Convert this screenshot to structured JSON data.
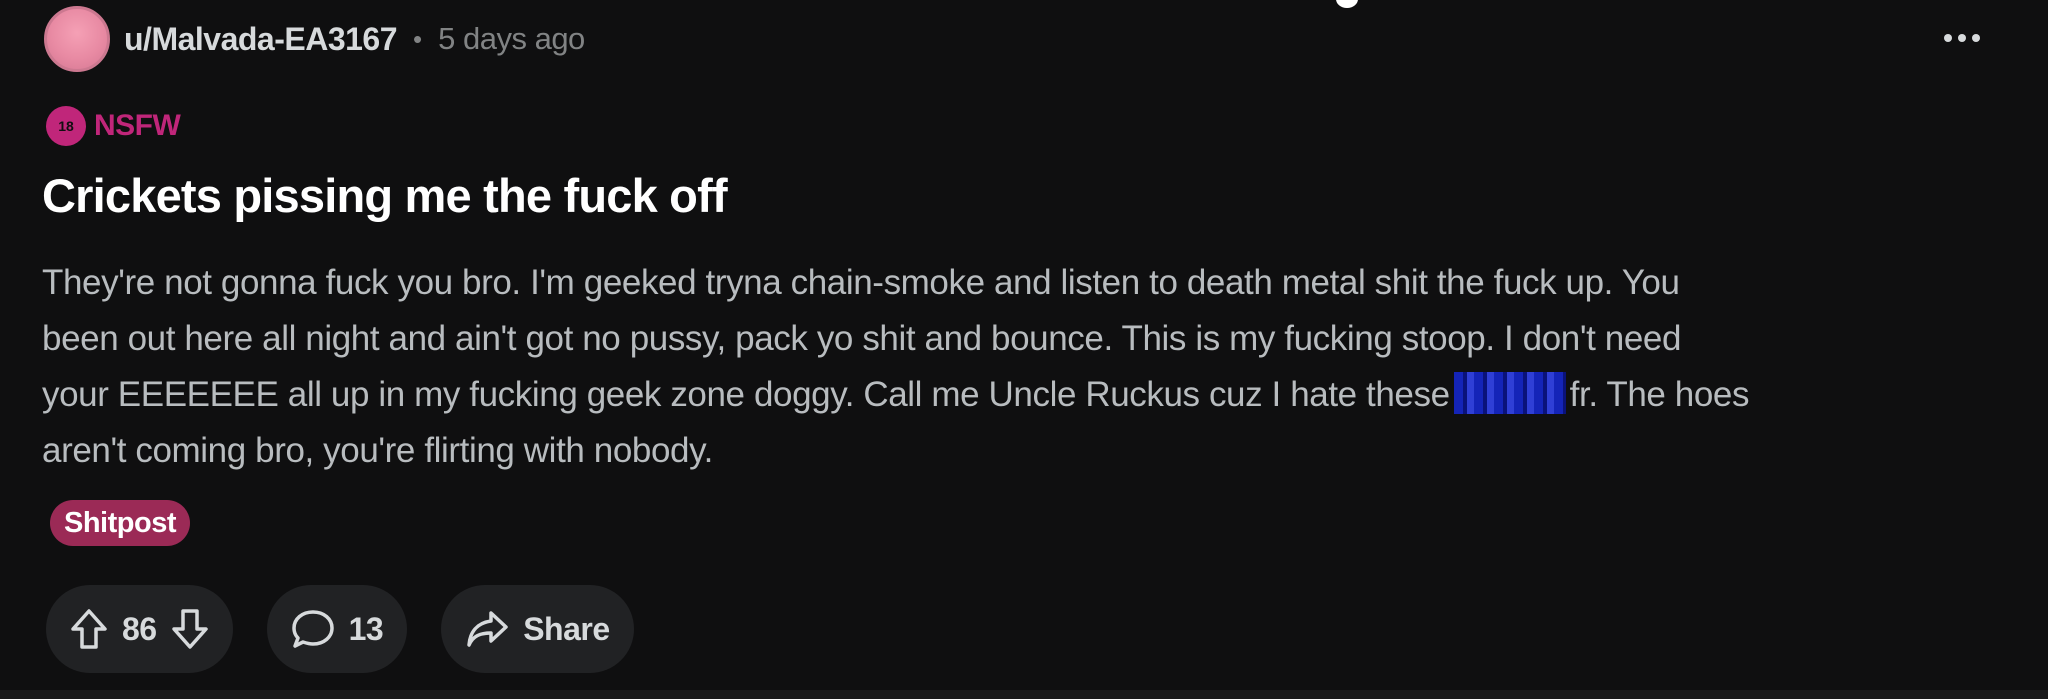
{
  "post": {
    "author": "u/Malvada-EA3167",
    "separator": "•",
    "time_ago": "5 days ago",
    "nsfw_label": "NSFW",
    "nsfw_badge_text": "18",
    "title": "Crickets pissing me the fuck off",
    "body_lines": [
      "They're not gonna fuck you bro. I'm geeked tryna chain-smoke and listen to death metal shit the fuck up. You",
      "been out here all night and ain't got no pussy, pack yo shit and bounce. This is my fucking stoop. I don't need",
      "your EEEEEEE all up in my fucking geek zone doggy. Call me Uncle Ruckus cuz I hate these",
      "fr. The hoes",
      "aren't coming bro, you're flirting with nobody."
    ],
    "flair": "Shitpost",
    "vote_count": "86",
    "comment_count": "13",
    "share_label": "Share"
  },
  "colors": {
    "background": "#0f0f10",
    "nsfw": "#c0267a",
    "flair_bg": "#9b2a56",
    "pill_bg": "#212224"
  },
  "icons": {
    "upvote": "arrow-up-icon",
    "downvote": "arrow-down-icon",
    "comment": "comment-bubble-icon",
    "share": "share-arrow-icon",
    "more": "more-horizontal-icon"
  }
}
